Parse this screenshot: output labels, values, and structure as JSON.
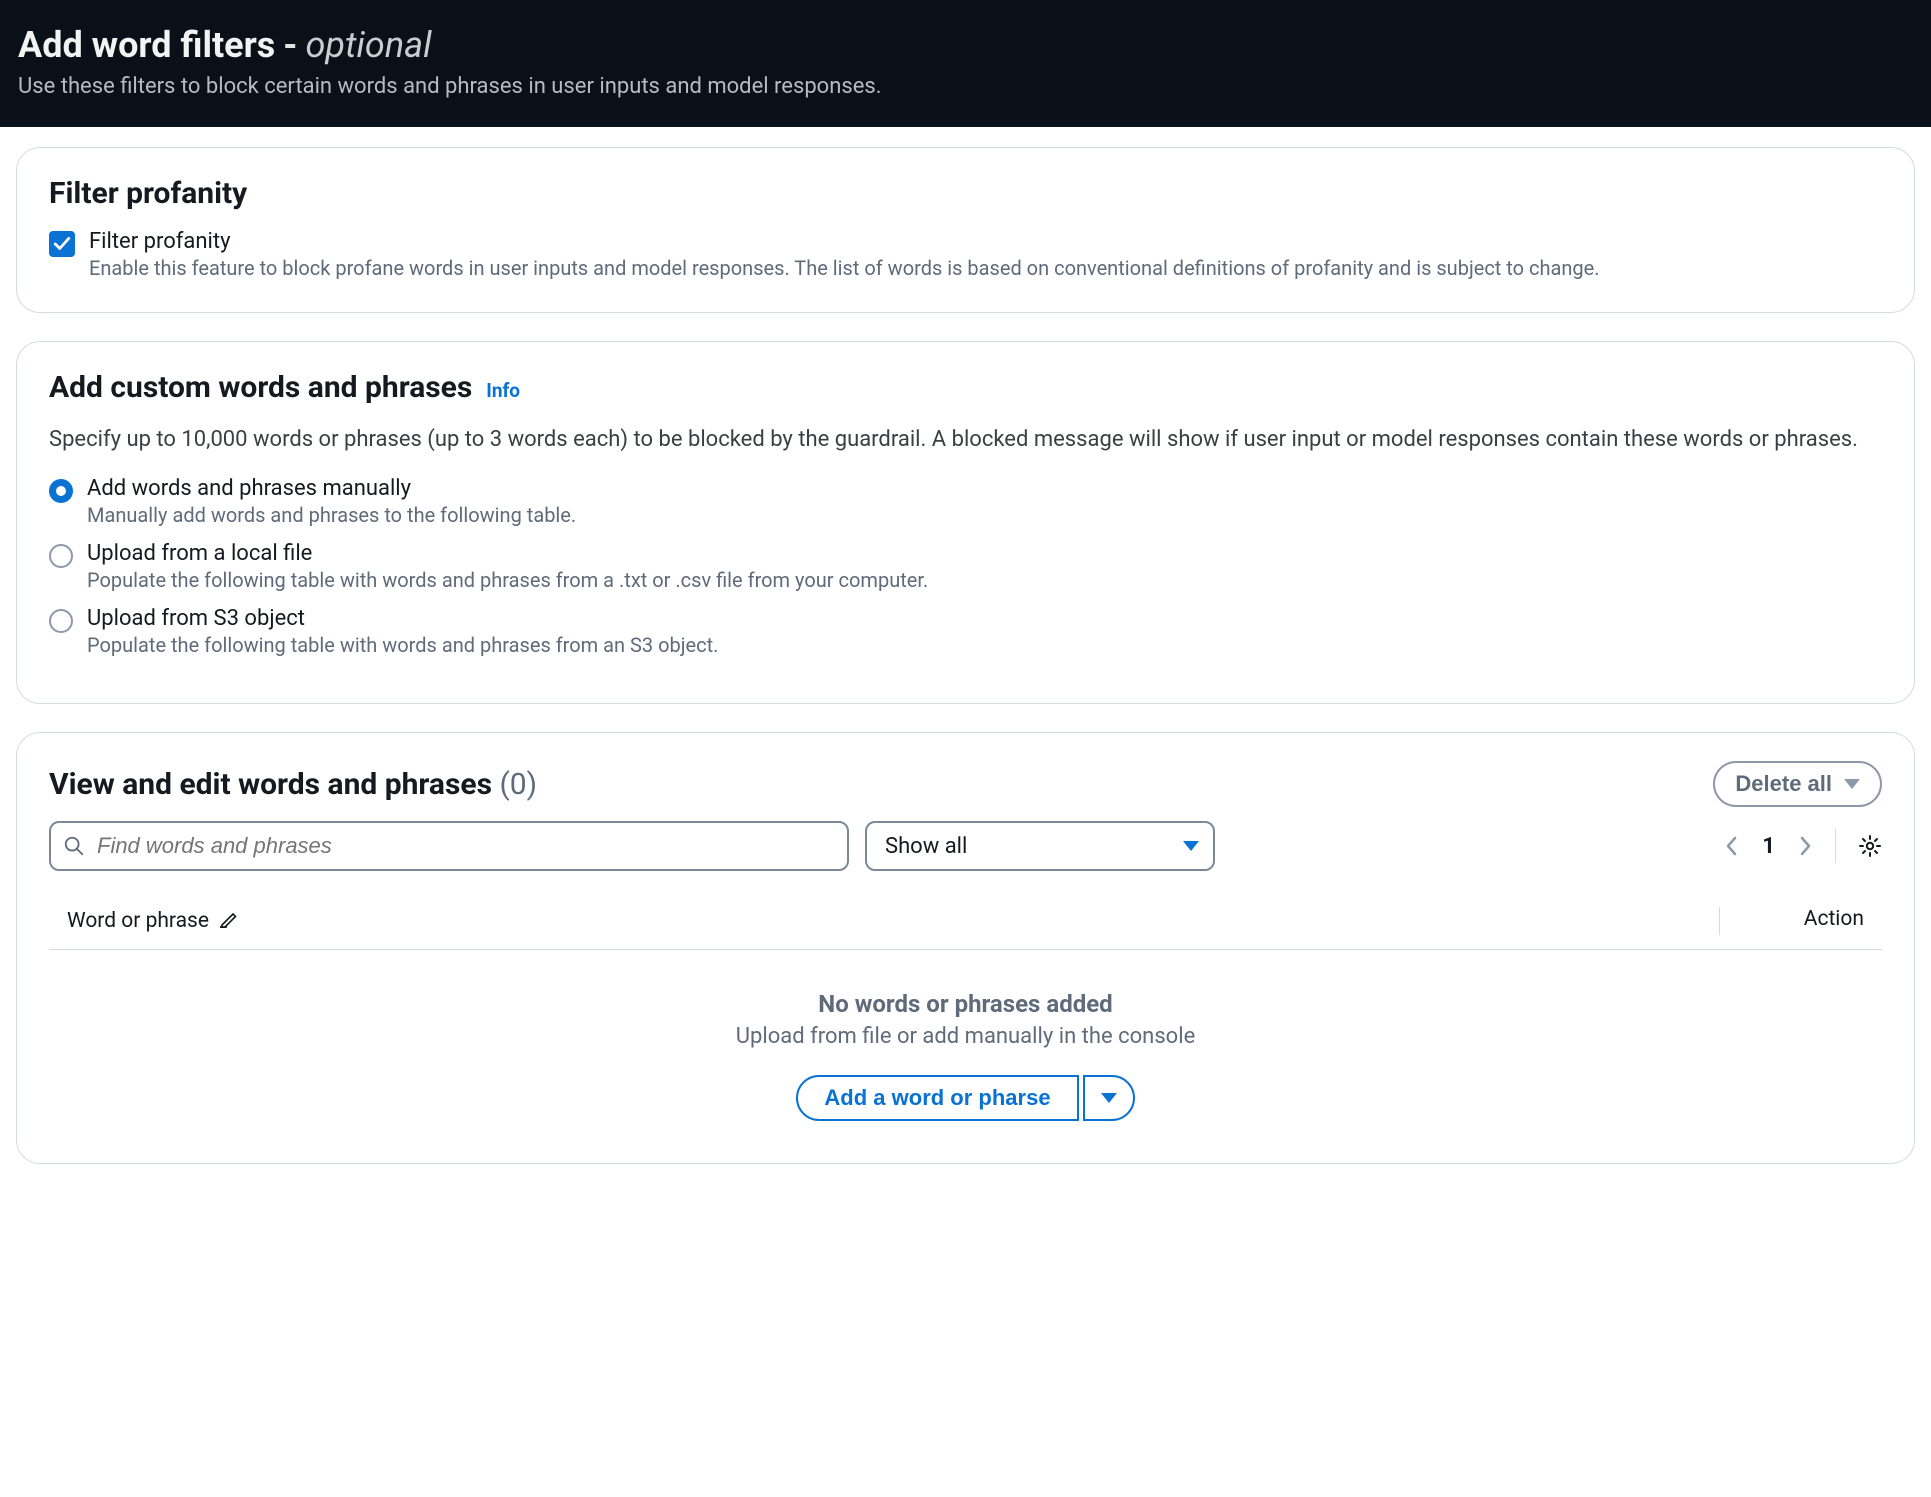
{
  "header": {
    "title_main": "Add word filters",
    "title_dash": "-",
    "title_optional": "optional",
    "subtitle": "Use these filters to block certain words and phrases in user inputs and model responses."
  },
  "profanity": {
    "panel_title": "Filter profanity",
    "checkbox_label": "Filter profanity",
    "checkbox_desc": "Enable this feature to block profane words in user inputs and model responses. The list of words is based on conventional definitions of profanity and is subject to change.",
    "checked": true
  },
  "custom": {
    "panel_title": "Add custom words and phrases",
    "info_label": "Info",
    "desc": "Specify up to 10,000 words or phrases (up to 3 words each) to be blocked by the guardrail. A blocked message will show if user input or model responses contain these words or phrases.",
    "options": [
      {
        "label": "Add words and phrases manually",
        "desc": "Manually add words and phrases to the following table.",
        "selected": true
      },
      {
        "label": "Upload from a local file",
        "desc": "Populate the following table with words and phrases from a .txt or .csv file from your computer.",
        "selected": false
      },
      {
        "label": "Upload from S3 object",
        "desc": "Populate the following table with words and phrases from an S3 object.",
        "selected": false
      }
    ]
  },
  "view": {
    "title": "View and edit words and phrases",
    "count": "(0)",
    "delete_all": "Delete all",
    "search_placeholder": "Find words and phrases",
    "filter_selected": "Show all",
    "page_number": "1",
    "columns": {
      "word": "Word or phrase",
      "action": "Action"
    },
    "empty_title": "No words or phrases added",
    "empty_sub": "Upload from file or add manually in the console",
    "add_button": "Add a word or pharse"
  }
}
